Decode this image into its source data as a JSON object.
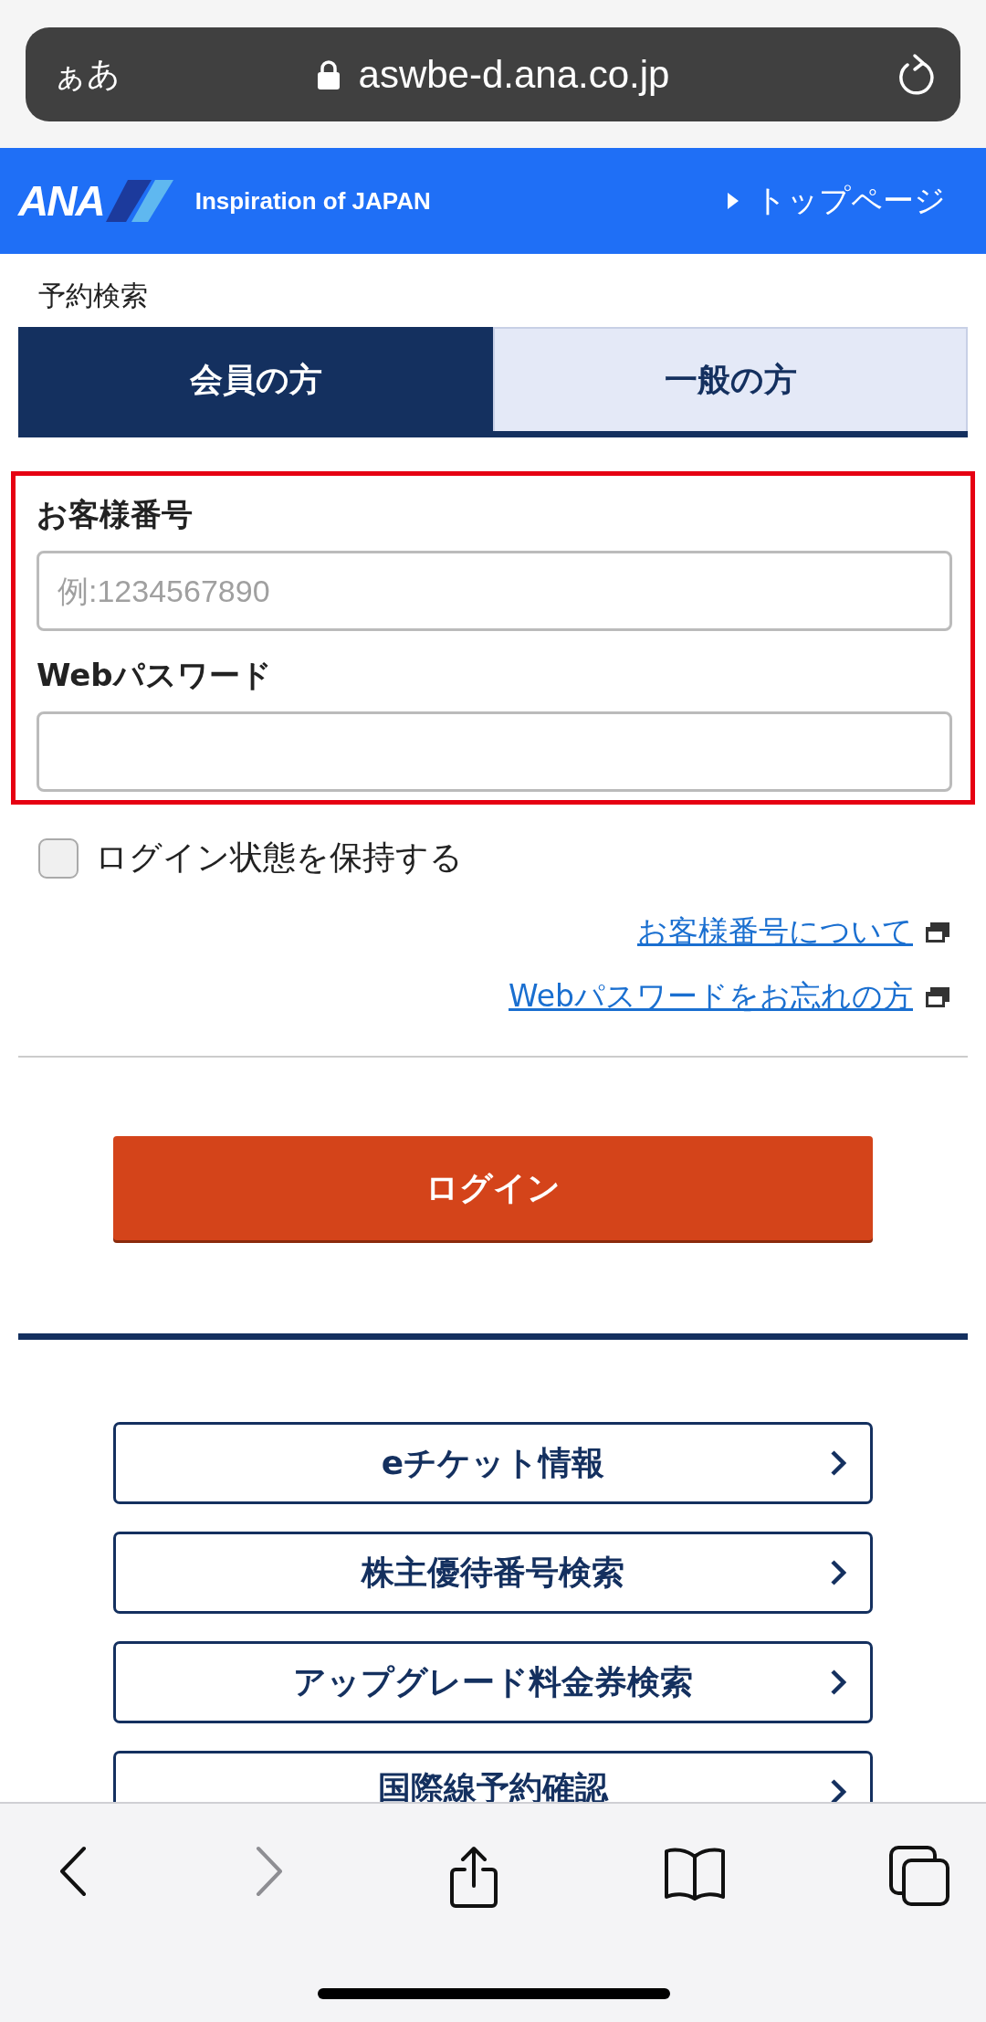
{
  "address_bar": {
    "text_size_button": "ぁあ",
    "url": "aswbe-d.ana.co.jp"
  },
  "header": {
    "logo_text": "ANA",
    "tagline": "Inspiration of JAPAN",
    "top_link": "トップページ"
  },
  "page_title": "予約検索",
  "tabs": [
    {
      "label": "会員の方",
      "selected": true
    },
    {
      "label": "一般の方",
      "selected": false
    }
  ],
  "form": {
    "fields": [
      {
        "label": "お客様番号",
        "placeholder": "例:1234567890"
      },
      {
        "label": "Webパスワード"
      }
    ]
  },
  "remember_login": {
    "label": "ログイン状態を保持する",
    "checked": false
  },
  "help_links": [
    "お客様番号について",
    "Webパスワードをお忘れの方"
  ],
  "login_button": "ログイン",
  "menu_buttons": [
    "eチケット情報",
    "株主優待番号検索",
    "アップグレード料金券検索",
    "国際線予約確認"
  ],
  "toolbar": [
    {
      "kind": "back",
      "disabled": false
    },
    {
      "kind": "forward",
      "disabled": true
    },
    {
      "kind": "share",
      "disabled": false
    },
    {
      "kind": "bookmarks",
      "disabled": false
    },
    {
      "kind": "tabs",
      "disabled": false
    }
  ]
}
